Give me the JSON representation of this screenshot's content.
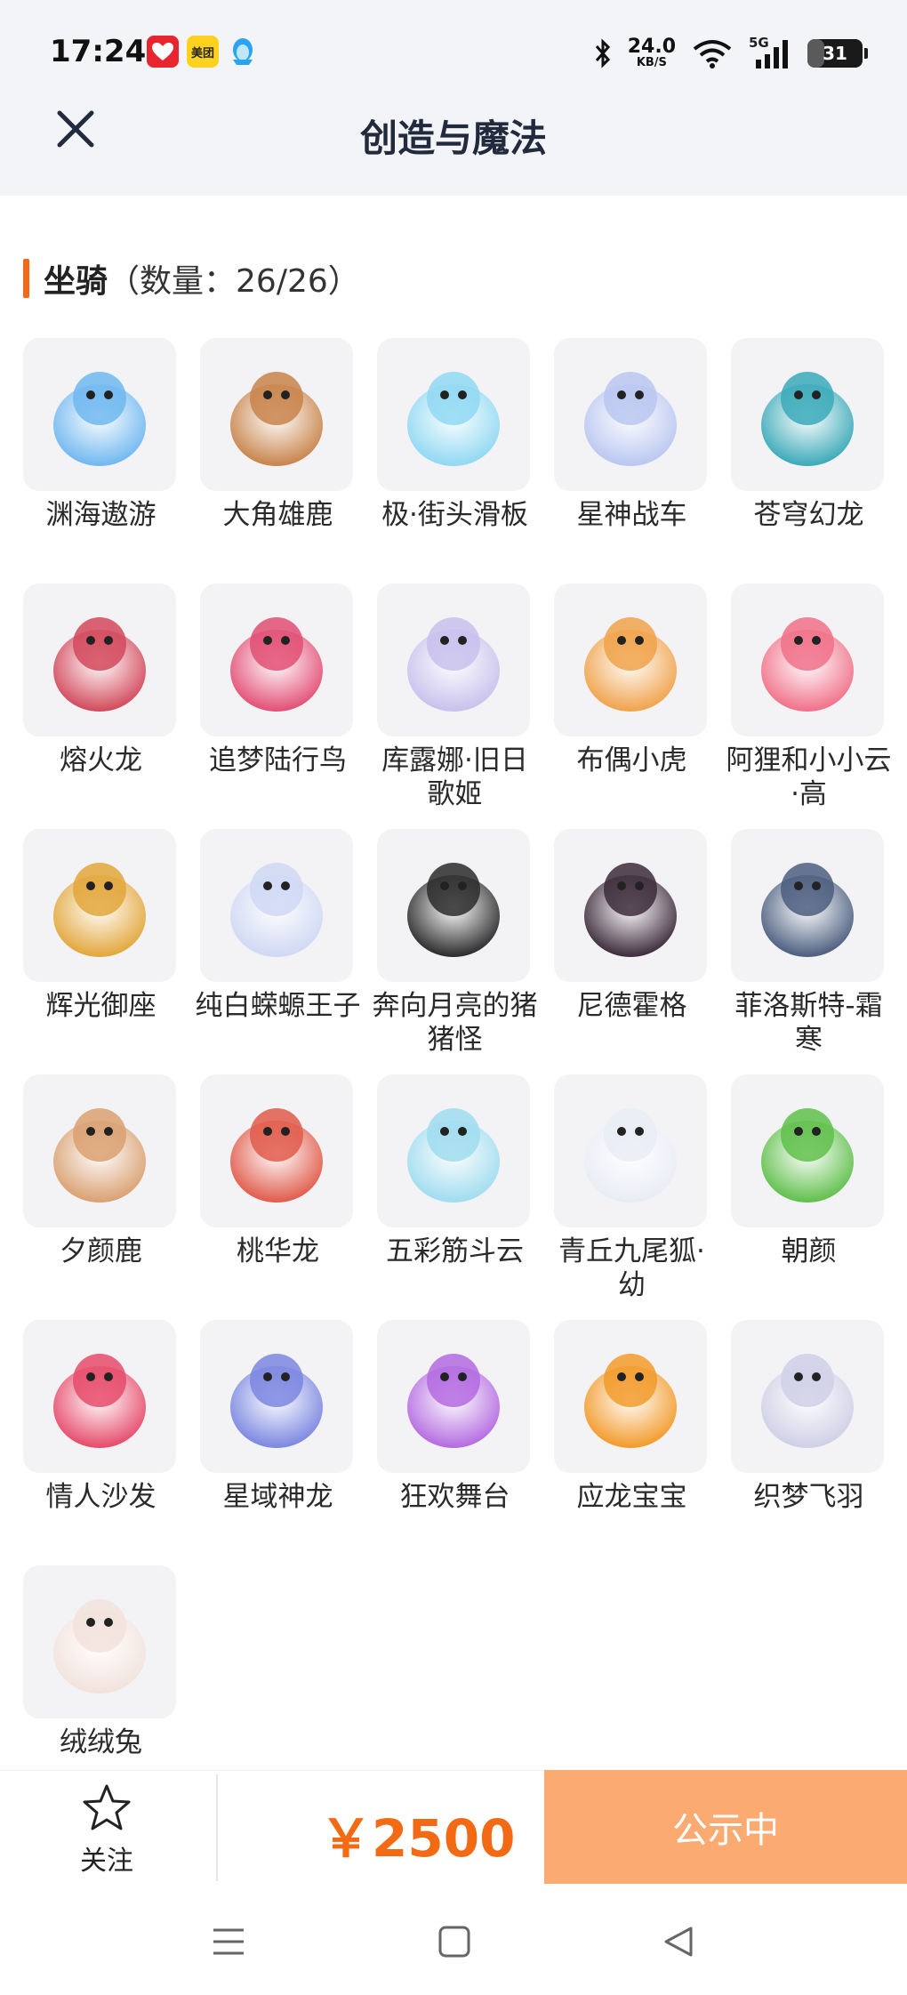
{
  "status_bar": {
    "time": "17:24",
    "apps": [
      {
        "label": "",
        "icon": "app-heart-icon",
        "color": "#e8242f"
      },
      {
        "label": "美团",
        "icon": "meituan-icon",
        "color": "#ffd21f"
      },
      {
        "label": "",
        "icon": "qq-penguin-icon",
        "color": "#29a3f2"
      }
    ],
    "speed_value": "24.0",
    "speed_unit": "KB/S",
    "network": "5G",
    "battery": "31",
    "battery_level": 0.31
  },
  "header": {
    "title": "创造与魔法"
  },
  "section": {
    "title": "坐骑",
    "count": "（数量：26/26）"
  },
  "mounts": [
    {
      "name": "渊海遨游",
      "icon": "blue-dragon-boy-icon",
      "color": "#6fb7f0"
    },
    {
      "name": "大角雄鹿",
      "icon": "antlered-deer-icon",
      "color": "#c8834a"
    },
    {
      "name": "极·街头滑板",
      "icon": "skateboard-icon",
      "color": "#8fd8f2"
    },
    {
      "name": "星神战车",
      "icon": "star-chariot-horse-icon",
      "color": "#b9c6f0"
    },
    {
      "name": "苍穹幻龙",
      "icon": "sky-dragon-icon",
      "color": "#3aa9b8"
    },
    {
      "name": "熔火龙",
      "icon": "lava-dragon-icon",
      "color": "#d2485a"
    },
    {
      "name": "追梦陆行鸟",
      "icon": "dream-bird-icon",
      "color": "#e24e74"
    },
    {
      "name": "库露娜·旧日歌姬",
      "icon": "songstress-icon",
      "color": "#c8c0ec"
    },
    {
      "name": "布偶小虎",
      "icon": "doll-tiger-icon",
      "color": "#f0a24a"
    },
    {
      "name": "阿狸和小小云·高",
      "icon": "ali-cloud-icon",
      "color": "#f07088"
    },
    {
      "name": "辉光御座",
      "icon": "radiant-throne-icon",
      "color": "#e2a63a"
    },
    {
      "name": "纯白蝾螈王子",
      "icon": "white-salamander-icon",
      "color": "#cfd8f4"
    },
    {
      "name": "奔向月亮的猪猪怪",
      "icon": "moon-pig-icon",
      "color": "#2a2a2a"
    },
    {
      "name": "尼德霍格",
      "icon": "nidhogg-dragon-icon",
      "color": "#3c2a3a"
    },
    {
      "name": "菲洛斯特-霜寒",
      "icon": "frost-dragon-icon",
      "color": "#4b5d7e"
    },
    {
      "name": "夕颜鹿",
      "icon": "evening-deer-icon",
      "color": "#d9a071"
    },
    {
      "name": "桃华龙",
      "icon": "peach-dragon-icon",
      "color": "#e05a4a"
    },
    {
      "name": "五彩筋斗云",
      "icon": "somersault-cloud-icon",
      "color": "#9fdcef"
    },
    {
      "name": "青丘九尾狐·幼",
      "icon": "nine-tail-fox-icon",
      "color": "#e9ecf5"
    },
    {
      "name": "朝颜",
      "icon": "morning-glory-icon",
      "color": "#5fbf4a"
    },
    {
      "name": "情人沙发",
      "icon": "lover-sofa-icon",
      "color": "#e64a6a"
    },
    {
      "name": "星域神龙",
      "icon": "star-realm-dragon-icon",
      "color": "#7a86e0"
    },
    {
      "name": "狂欢舞台",
      "icon": "carnival-stage-icon",
      "color": "#b36ae0"
    },
    {
      "name": "应龙宝宝",
      "icon": "baby-yinglong-icon",
      "color": "#f29a2a"
    },
    {
      "name": "织梦飞羽",
      "icon": "dream-feather-icon",
      "color": "#cfcfe6"
    },
    {
      "name": "绒绒兔",
      "icon": "fluffy-rabbit-icon",
      "color": "#f2e2dc"
    }
  ],
  "footer": {
    "follow_label": "关注",
    "price": "￥2500",
    "cta_label": "公示中",
    "cta_color": "#fbaa72",
    "price_color": "#f26a14"
  },
  "nav": {
    "menu": "menu-icon",
    "home": "home-icon",
    "back": "back-icon"
  }
}
